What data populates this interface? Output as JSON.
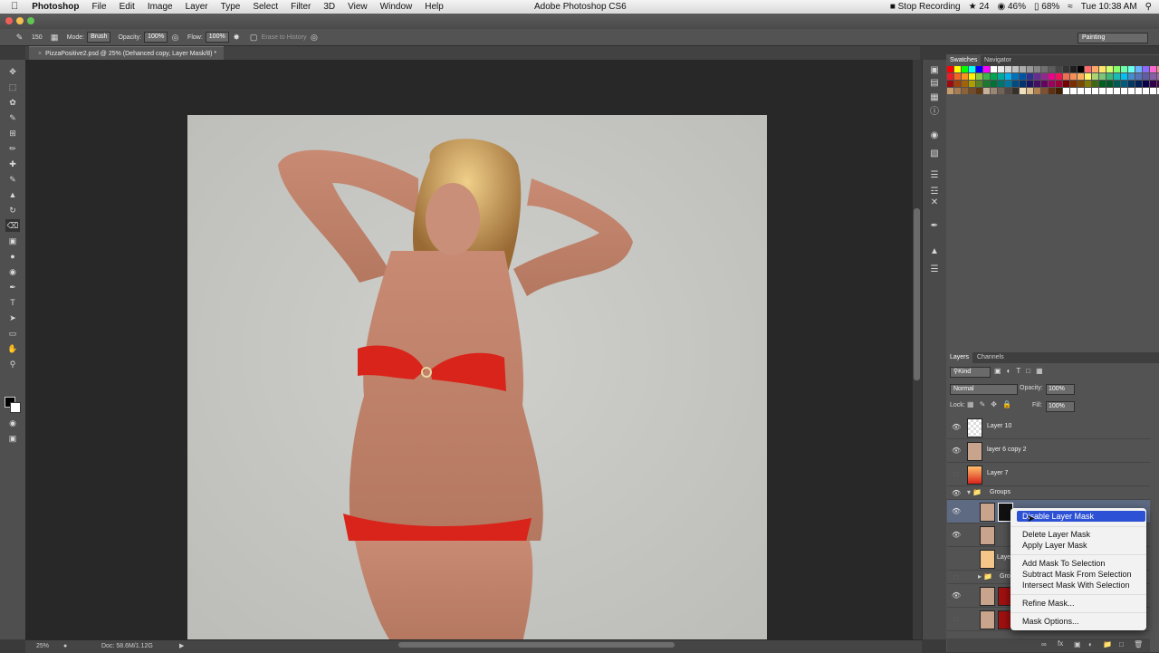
{
  "menubar": {
    "app_name": "Photoshop",
    "items": [
      "File",
      "Edit",
      "Image",
      "Layer",
      "Type",
      "Select",
      "Filter",
      "3D",
      "View",
      "Window",
      "Help"
    ],
    "window_title": "Adobe Photoshop CS6",
    "status": [
      "Stop Recording",
      "24",
      "46%",
      "68%",
      "Tue 10:38 AM"
    ]
  },
  "options": {
    "brush_size": "150",
    "mode_label": "Mode:",
    "mode_value": "Brush",
    "opacity_label": "Opacity:",
    "opacity_value": "100%",
    "flow_label": "Flow:",
    "flow_value": "100%",
    "erase_history": "Erase to History",
    "workspace": "Painting"
  },
  "document": {
    "tab_title": "PizzaPositive2.psd @ 25% (Dehanced copy, Layer Mask/8) *",
    "zoom": "25%",
    "doc_size": "Doc: 58.6M/1.12G"
  },
  "swatches_panel": {
    "tabs": [
      "Swatches",
      "Navigator"
    ],
    "colors": [
      "#ff0000",
      "#ffff00",
      "#00ff00",
      "#00ffff",
      "#0000ff",
      "#ff00ff",
      "#ffffff",
      "#ebebeb",
      "#d6d6d6",
      "#c2c2c2",
      "#adadad",
      "#999999",
      "#858585",
      "#707070",
      "#5c5c5c",
      "#474747",
      "#333333",
      "#1f1f1f",
      "#000000",
      "#ff6a6a",
      "#ffa86a",
      "#ffe66a",
      "#d2ff6a",
      "#88ff6a",
      "#6affa8",
      "#6affee",
      "#6ab4ff",
      "#8a6aff",
      "#ff6ad2",
      "#ff8888",
      "#ffcc99",
      "#cccccc",
      "#ed1c24",
      "#f26522",
      "#f7941d",
      "#fff200",
      "#8dc63f",
      "#39b54a",
      "#00a651",
      "#00a99d",
      "#00aeef",
      "#0072bc",
      "#0054a6",
      "#2e3192",
      "#662d91",
      "#92278f",
      "#ec008c",
      "#ed145b",
      "#f26c4f",
      "#f68e56",
      "#fbaf5d",
      "#fff568",
      "#acd373",
      "#7cc576",
      "#3cb878",
      "#1abbb4",
      "#00bff3",
      "#448ccb",
      "#5574b9",
      "#605ca8",
      "#8560a8",
      "#a864a8",
      "#f06eaa",
      "#f26d7d",
      "#9e0b0f",
      "#a0410d",
      "#a36209",
      "#aba000",
      "#598527",
      "#1a7b30",
      "#007236",
      "#00746b",
      "#0076a3",
      "#004b80",
      "#003471",
      "#1b1464",
      "#440e62",
      "#630460",
      "#9e005d",
      "#9e0039",
      "#790000",
      "#7b2e00",
      "#7d4900",
      "#827b00",
      "#406618",
      "#005e20",
      "#005826",
      "#005952",
      "#005b7f",
      "#003663",
      "#002157",
      "#0d004c",
      "#32004b",
      "#4b0049",
      "#7b0046",
      "#7a0026",
      "#c69c6d",
      "#a67c52",
      "#8c6239",
      "#754c24",
      "#603913",
      "#c7b299",
      "#998675",
      "#736357",
      "#534741",
      "#37302a",
      "#f0e0c0",
      "#e0c090",
      "#b08050",
      "#805030",
      "#603010",
      "#402000",
      "#ffffff",
      "#ffffff",
      "#ffffff",
      "#ffffff",
      "#ffffff",
      "#ffffff",
      "#ffffff",
      "#ffffff",
      "#ffffff",
      "#ffffff",
      "#ffffff",
      "#ffffff",
      "#ffffff",
      "#ffffff",
      "#ffffff",
      "#ffffff"
    ]
  },
  "layers_panel": {
    "tabs": [
      "Layers",
      "Channels"
    ],
    "kind": "Kind",
    "blend": "Normal",
    "opacity_label": "Opacity:",
    "opacity_value": "100%",
    "lock_label": "Lock:",
    "fill_label": "Fill:",
    "fill_value": "100%",
    "layers": [
      "Layer 10",
      "layer 6 copy 2",
      "Layer 7",
      "Groups",
      "Layer",
      "Grou"
    ]
  },
  "context_menu": {
    "items": [
      "Disable Layer Mask",
      "Delete Layer Mask",
      "Apply Layer Mask",
      "Add Mask To Selection",
      "Subtract Mask From Selection",
      "Intersect Mask With Selection",
      "Refine Mask...",
      "Mask Options..."
    ]
  },
  "colors": {
    "accent": "#2c51d4",
    "panel": "#535353",
    "canvas_bg": "#282828"
  }
}
